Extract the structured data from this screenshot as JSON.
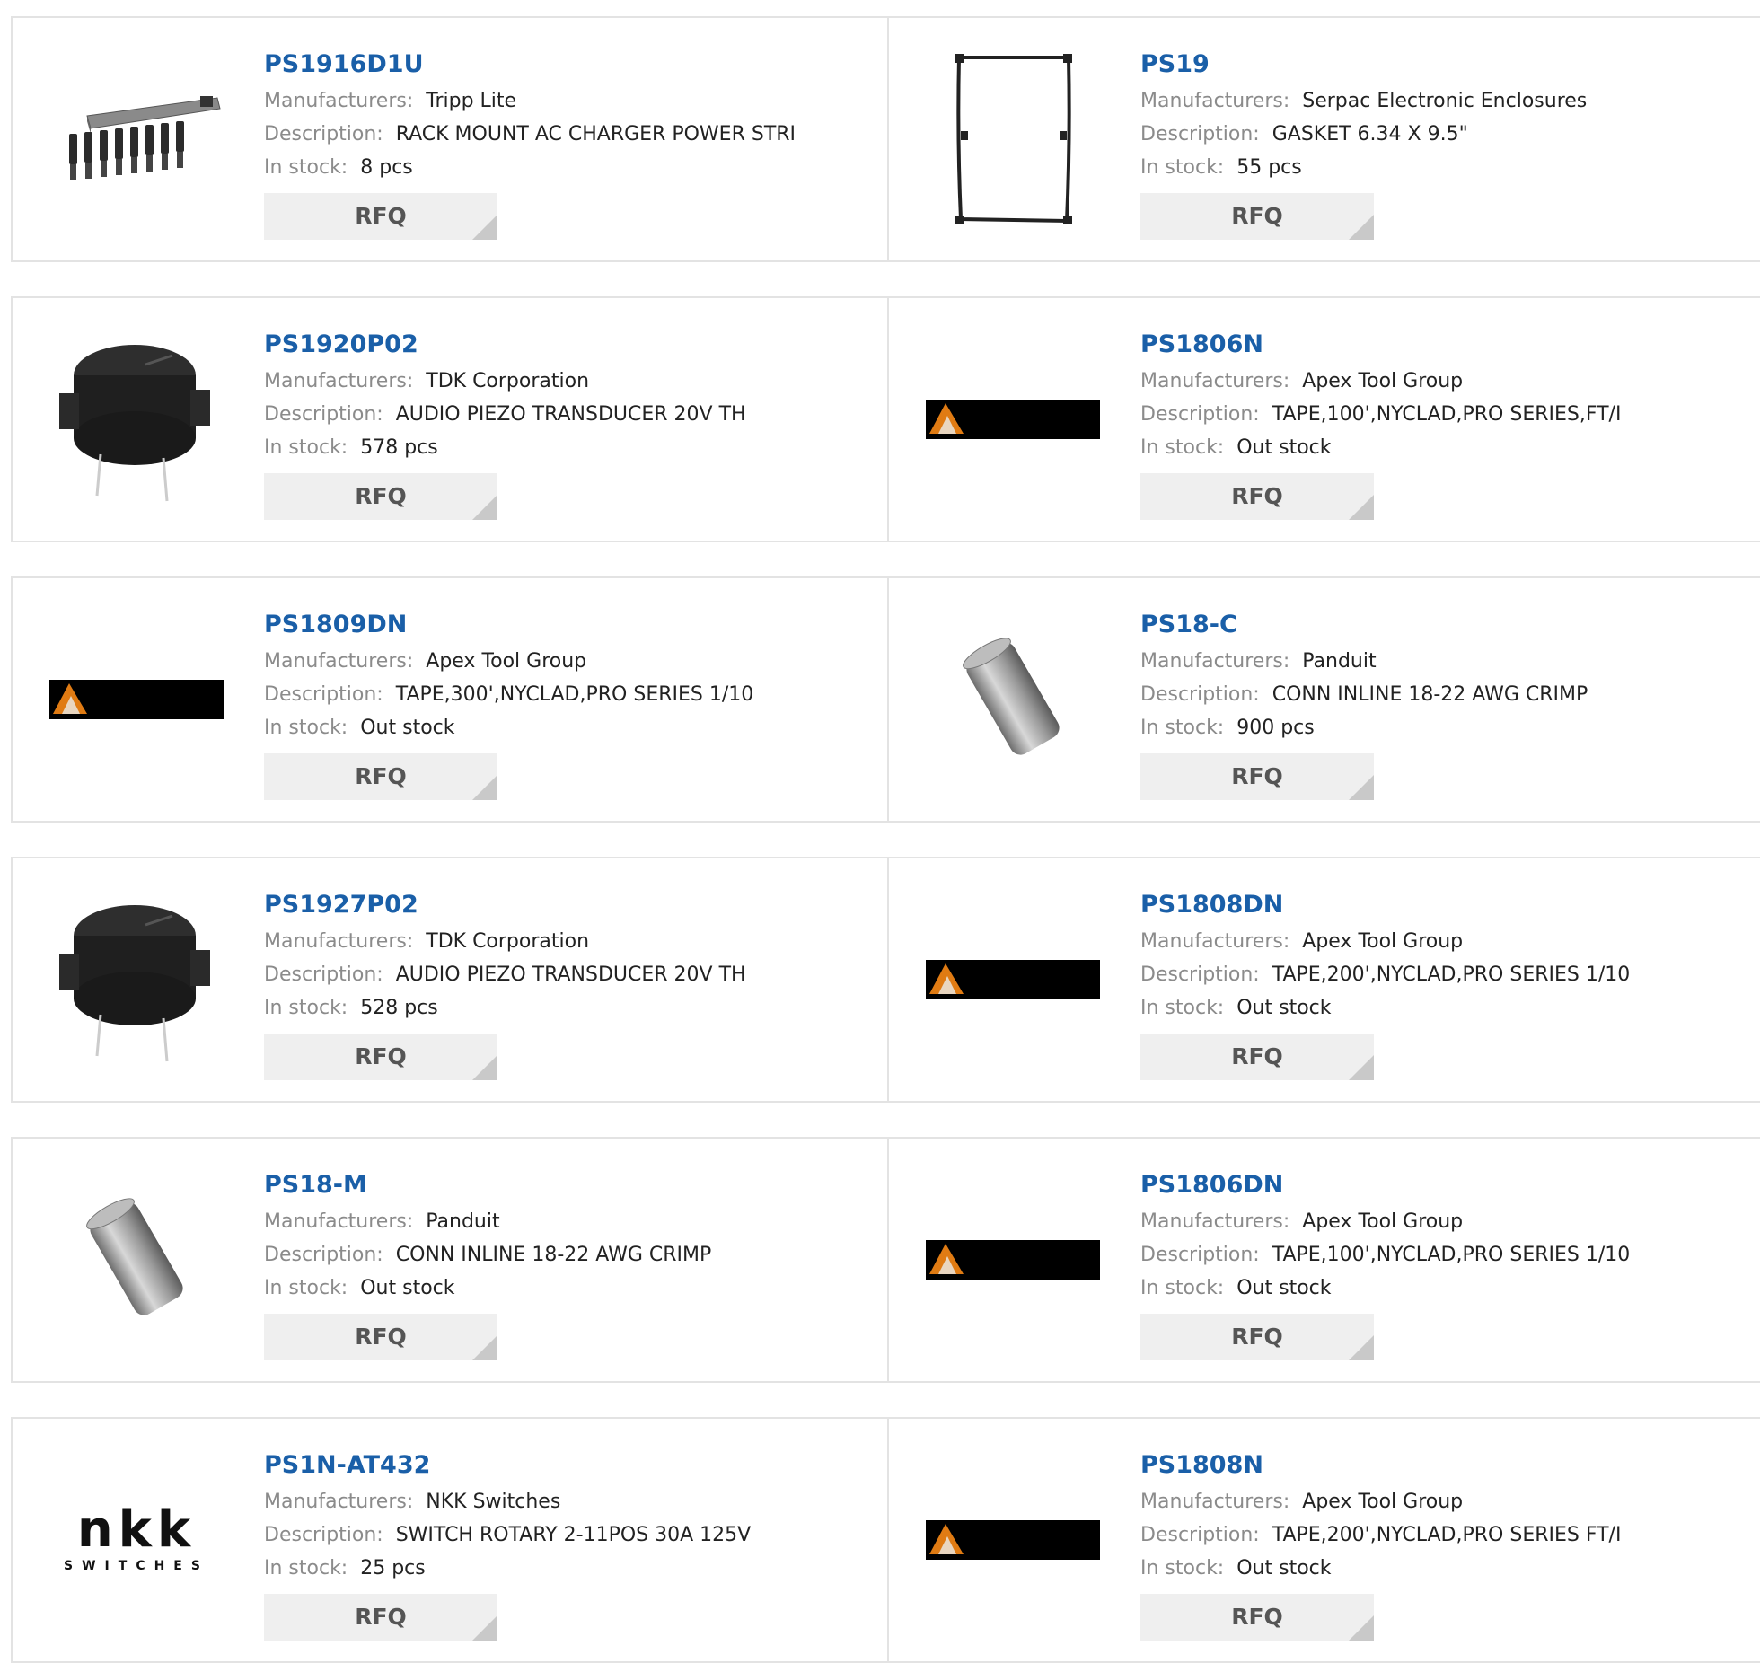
{
  "labels": {
    "manufacturers": "Manufacturers:",
    "description": "Description:",
    "in_stock": "In stock:",
    "rfq": "RFQ"
  },
  "products": [
    {
      "part": "PS1916D1U",
      "manufacturer": "Tripp Lite",
      "description": "RACK MOUNT AC CHARGER POWER STRI",
      "stock": "8 pcs",
      "image": "power-strip-image"
    },
    {
      "part": "PS19",
      "manufacturer": "Serpac Electronic Enclosures",
      "description": "GASKET 6.34 X 9.5\"",
      "stock": "55 pcs",
      "image": "gasket-image"
    },
    {
      "part": "PS1920P02",
      "manufacturer": "TDK Corporation",
      "description": "AUDIO PIEZO TRANSDUCER 20V TH",
      "stock": "578 pcs",
      "image": "piezo-buzzer-image"
    },
    {
      "part": "PS1806N",
      "manufacturer": "Apex Tool Group",
      "description": "TAPE,100',NYCLAD,PRO SERIES,FT/I",
      "stock": "Out stock",
      "image": "apex-logo"
    },
    {
      "part": "PS1809DN",
      "manufacturer": "Apex Tool Group",
      "description": "TAPE,300',NYCLAD,PRO SERIES 1/10",
      "stock": "Out stock",
      "image": "apex-logo"
    },
    {
      "part": "PS18-C",
      "manufacturer": "Panduit",
      "description": "CONN INLINE 18-22 AWG CRIMP",
      "stock": "900 pcs",
      "image": "crimp-connector-image"
    },
    {
      "part": "PS1927P02",
      "manufacturer": "TDK Corporation",
      "description": "AUDIO PIEZO TRANSDUCER 20V TH",
      "stock": "528 pcs",
      "image": "piezo-buzzer-image"
    },
    {
      "part": "PS1808DN",
      "manufacturer": "Apex Tool Group",
      "description": "TAPE,200',NYCLAD,PRO SERIES 1/10",
      "stock": "Out stock",
      "image": "apex-logo"
    },
    {
      "part": "PS18-M",
      "manufacturer": "Panduit",
      "description": "CONN INLINE 18-22 AWG CRIMP",
      "stock": "Out stock",
      "image": "crimp-connector-image"
    },
    {
      "part": "PS1806DN",
      "manufacturer": "Apex Tool Group",
      "description": "TAPE,100',NYCLAD,PRO SERIES 1/10",
      "stock": "Out stock",
      "image": "apex-logo"
    },
    {
      "part": "PS1N-AT432",
      "manufacturer": "NKK Switches",
      "description": "SWITCH ROTARY 2-11POS 30A 125V",
      "stock": "25 pcs",
      "image": "nkk-logo",
      "logo_text": "nkk",
      "logo_subtext": "SWITCHES"
    },
    {
      "part": "PS1808N",
      "manufacturer": "Apex Tool Group",
      "description": "TAPE,200',NYCLAD,PRO SERIES FT/I",
      "stock": "Out stock",
      "image": "apex-logo"
    }
  ],
  "colors": {
    "part_link": "#1a5fa8",
    "label": "#8b8b8b",
    "border": "#e3e3e3",
    "rfq_bg": "#efefef"
  }
}
